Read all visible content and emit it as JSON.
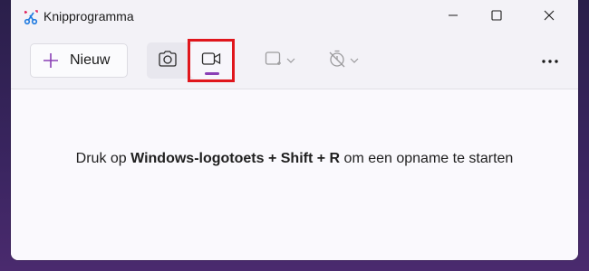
{
  "window": {
    "title": "Knipprogramma",
    "controls": {
      "minimize": "minimize-icon",
      "maximize": "maximize-icon",
      "close": "close-icon"
    }
  },
  "toolbar": {
    "new_label": "Nieuw",
    "modes": [
      {
        "icon": "camera-icon",
        "name": "screenshot-mode",
        "selected": false
      },
      {
        "icon": "video-icon",
        "name": "record-mode",
        "selected": true
      }
    ],
    "shape_dropdown_icon": "rectangle-snip-icon",
    "timer_dropdown_icon": "timer-off-icon",
    "more_icon": "more-dots-icon"
  },
  "content": {
    "instruction_prefix": "Druk op ",
    "key_1": "Windows-logotoets",
    "plus_1": " + ",
    "key_2": "Shift",
    "plus_2": " + ",
    "key_3": "R",
    "instruction_suffix": " om een opname te starten"
  },
  "colors": {
    "accent": "#8a3fb5",
    "highlight_box": "#e0161c",
    "window_bg": "#f3f2f7",
    "content_bg": "#faf9fd"
  }
}
